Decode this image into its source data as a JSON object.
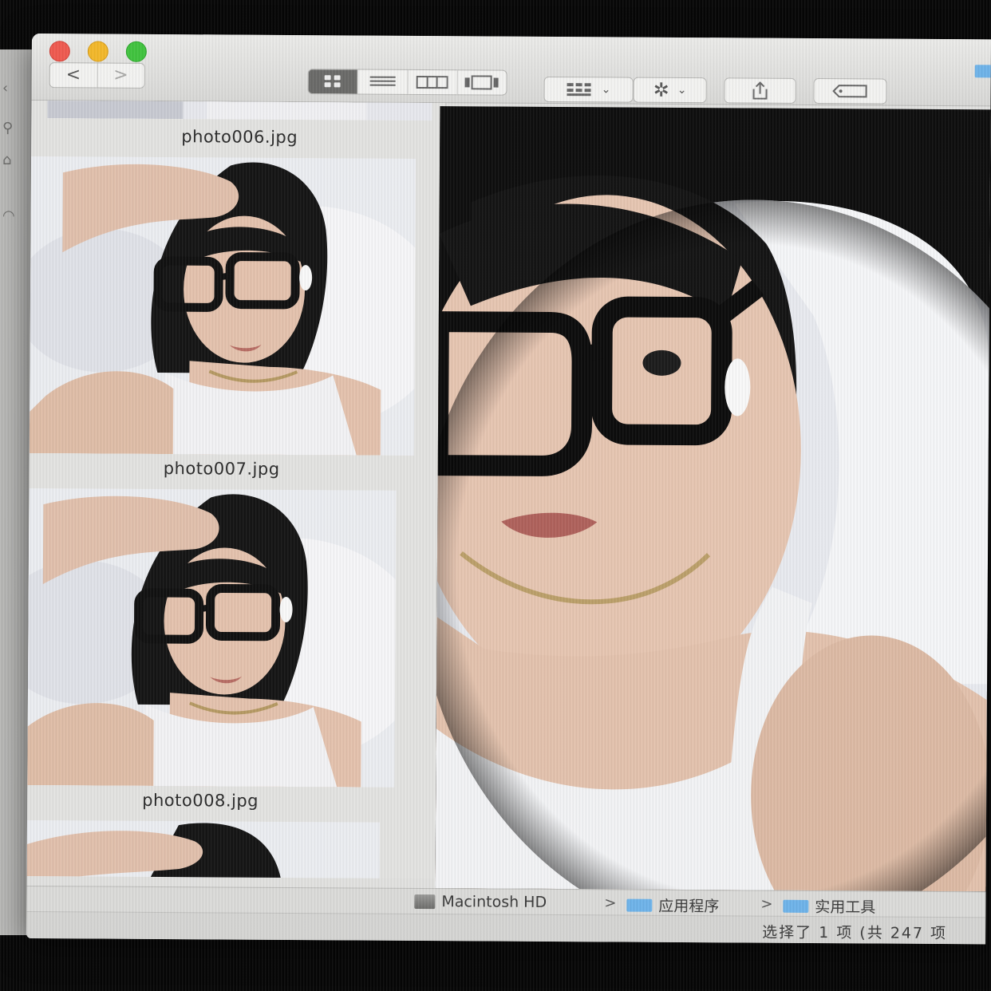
{
  "window": {
    "back_label": "<",
    "forward_label": ">",
    "toolbar": {
      "views": [
        {
          "name": "icon-view",
          "active": true
        },
        {
          "name": "list-view",
          "active": false
        },
        {
          "name": "column-view",
          "active": false
        },
        {
          "name": "gallery-view",
          "active": false
        }
      ],
      "group_icon": "group-icon",
      "action_icon": "gear-icon",
      "share_icon": "share-icon",
      "tag_icon": "tag-icon"
    }
  },
  "files": [
    {
      "name": "photo006.jpg"
    },
    {
      "name": "photo007.jpg"
    },
    {
      "name": "photo008.jpg"
    }
  ],
  "pathbar": {
    "disk": "Macintosh HD",
    "folder1": "应用程序",
    "folder2": "实用工具",
    "separator": ">"
  },
  "statusbar": {
    "text": "选择了 1 项 (共 247 项"
  },
  "colors": {
    "close": "#f05a50",
    "minimize": "#f4b92b",
    "zoom": "#41c43f",
    "folder": "#6fb4ea"
  }
}
